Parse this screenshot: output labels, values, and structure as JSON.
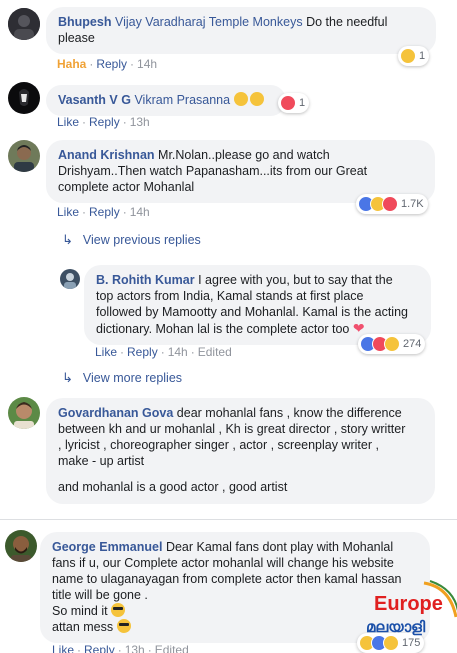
{
  "comments": [
    {
      "author": "Bhupesh",
      "mention": "Vijay Varadharaj Temple Monkeys",
      "text_line1": "Do the needful",
      "text_line2": "please",
      "reaction_label": "Haha",
      "reply": "Reply",
      "time": "14h",
      "reaction_count": "1"
    },
    {
      "author": "Vasanth V G",
      "mention": "Vikram Prasanna",
      "like": "Like",
      "reply": "Reply",
      "time": "13h",
      "reaction_count": "1"
    },
    {
      "author": "Anand Krishnan",
      "text_line1": "Mr.Nolan..please go and watch",
      "text_line2": "Drishyam..Then watch Papanasham...its from our Great",
      "text_line3": "complete actor Mohanlal",
      "like": "Like",
      "reply": "Reply",
      "time": "14h",
      "reaction_count": "1.7K",
      "view_previous": "View previous replies"
    },
    {
      "author": "B. Rohith Kumar",
      "text_line1": "I agree with you, but to say that the",
      "text_line2": "top actors from India, Kamal stands at first place",
      "text_line3": "followed by Mamootty and Mohanlal. Kamal is the acting",
      "text_line4": "dictionary. Mohan lal is the complete actor too",
      "like": "Like",
      "reply": "Reply",
      "time": "14h",
      "edited": "Edited",
      "reaction_count": "274",
      "view_more": "View more replies"
    },
    {
      "author": "Govardhanan Gova",
      "text_line1": "dear mohanlal fans , know the difference",
      "text_line2": "between kh and ur mohanlal , Kh is great director , story writter",
      "text_line3": ", lyricist , choreographer singer , actor , screenplay writer ,",
      "text_line4": "make - up artist",
      "text_line5": "and mohanlal is a good actor , good artist"
    },
    {
      "author": "George Emmanuel",
      "text_line1": "Dear Kamal fans dont play with Mohanlal",
      "text_line2": "fans if u, our Complete actor mohanlal will change his website",
      "text_line3": "name to ulaganayagan from complete actor then kamal hassan",
      "text_line4": "title will be gone .",
      "text_line5": "So mind it",
      "text_line6": "attan mess",
      "like": "Like",
      "reply": "Reply",
      "time": "13h",
      "edited": "Edited",
      "reaction_count": "175"
    }
  ],
  "watermark": {
    "word1": "Europe",
    "word2": "മലയാളി"
  },
  "colors": {
    "link": "#385898",
    "bubble": "#f2f3f5",
    "haha": "#f0a236"
  }
}
